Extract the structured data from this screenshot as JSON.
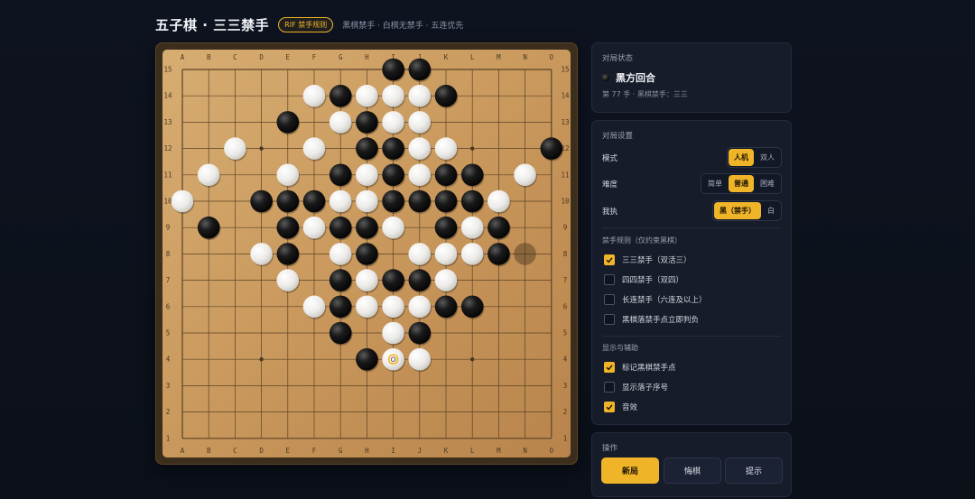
{
  "header": {
    "title": "五子棋 · 三三禁手",
    "badge": "RIF 禁手规则",
    "subtitle": "黑棋禁手 · 白棋无禁手 · 五连优先"
  },
  "board": {
    "columns": [
      "A",
      "B",
      "C",
      "D",
      "E",
      "F",
      "G",
      "H",
      "I",
      "J",
      "K",
      "L",
      "M",
      "N",
      "O"
    ],
    "rows": [
      "15",
      "14",
      "13",
      "12",
      "11",
      "10",
      "9",
      "8",
      "7",
      "6",
      "5",
      "4",
      "3",
      "2",
      "1"
    ],
    "black": [
      "I15",
      "J15",
      "G14",
      "K14",
      "E13",
      "H13",
      "H12",
      "I12",
      "O12",
      "G11",
      "I11",
      "K11",
      "L11",
      "D10",
      "E10",
      "F10",
      "I10",
      "J10",
      "K10",
      "L10",
      "B9",
      "E9",
      "G9",
      "H9",
      "K9",
      "M9",
      "E8",
      "H8",
      "M8",
      "G7",
      "I7",
      "J7",
      "G6",
      "K6",
      "L6",
      "G5",
      "J5",
      "H4"
    ],
    "white": [
      "F14",
      "H14",
      "I14",
      "J14",
      "G13",
      "I13",
      "J13",
      "C12",
      "F12",
      "J12",
      "K12",
      "B11",
      "E11",
      "H11",
      "J11",
      "N11",
      "A10",
      "G10",
      "H10",
      "M10",
      "F9",
      "I9",
      "L9",
      "D8",
      "G8",
      "J8",
      "K8",
      "L8",
      "E7",
      "H7",
      "K7",
      "F6",
      "H6",
      "I6",
      "J6",
      "I5",
      "I4",
      "J4"
    ],
    "ghost": "N8",
    "last_move": "I4",
    "star_points": [
      "D12",
      "L12",
      "H8",
      "D4",
      "L4"
    ],
    "colors": {
      "black": "#111111",
      "white": "#f5f5f5",
      "accent": "#f0b429",
      "wood": "#d0a268"
    }
  },
  "status": {
    "title": "对局状态",
    "turn": "黑方回合",
    "move_info": "第 77 手 · 黑棋禁手：三三"
  },
  "settings": {
    "title": "对局设置",
    "mode_label": "模式",
    "mode_options": [
      "人机",
      "双人"
    ],
    "mode_selected": "人机",
    "difficulty_label": "难度",
    "difficulty_options": [
      "简单",
      "普通",
      "困难"
    ],
    "difficulty_selected": "普通",
    "side_label": "我执",
    "side_options": [
      "黑（禁手）",
      "白"
    ],
    "side_selected": "黑（禁手）",
    "forbidden_title": "禁手规则（仅约束黑棋）",
    "forbidden_rules": [
      {
        "label": "三三禁手（双活三）",
        "checked": true
      },
      {
        "label": "四四禁手（双四）",
        "checked": false
      },
      {
        "label": "长连禁手（六连及以上）",
        "checked": false
      },
      {
        "label": "黑棋落禁手点立即判负",
        "checked": false
      }
    ],
    "display_title": "显示与辅助",
    "display_options": [
      {
        "label": "标记黑棋禁手点",
        "checked": true
      },
      {
        "label": "显示落子序号",
        "checked": false
      },
      {
        "label": "音效",
        "checked": true
      }
    ]
  },
  "ops": {
    "title": "操作",
    "new_game": "新局",
    "undo": "悔棋",
    "hint": "提示"
  }
}
